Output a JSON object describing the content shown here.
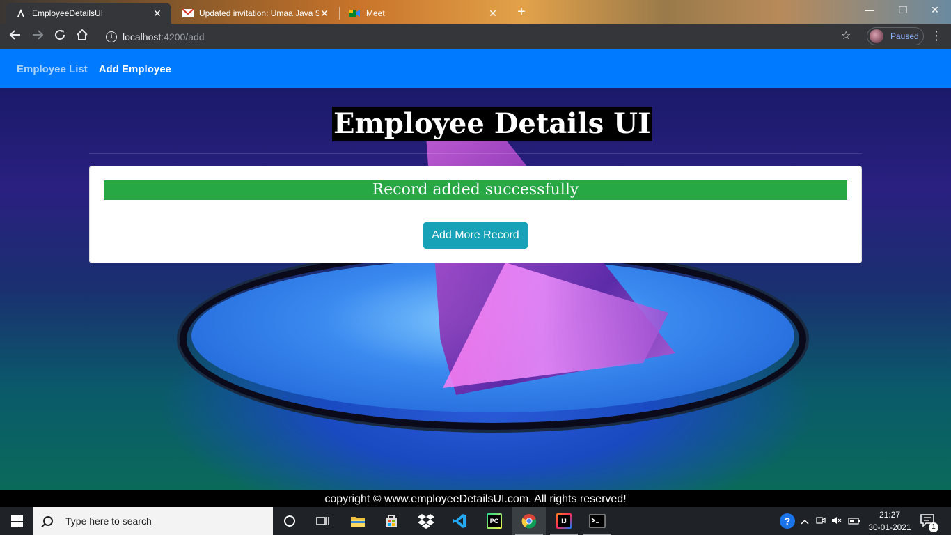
{
  "browser": {
    "tabs": [
      {
        "title": "EmployeeDetailsUI",
        "favicon": "A",
        "active": true
      },
      {
        "title": "Updated invitation: Umaa Java S",
        "favicon": "M",
        "active": false
      },
      {
        "title": "Meet",
        "favicon": "meet",
        "active": false
      }
    ],
    "close_glyph": "✕",
    "new_tab_glyph": "+",
    "url_host": "localhost",
    "url_path": ":4200/add",
    "profile_label": "Paused"
  },
  "navbar": {
    "links": [
      {
        "label": "Employee List",
        "active": false
      },
      {
        "label": "Add Employee",
        "active": true
      }
    ],
    "color": "#007bff"
  },
  "main": {
    "title": "Employee Details UI",
    "alert_text": "Record added successfully",
    "alert_color": "#28a745",
    "button_label": "Add More Record",
    "button_color": "#17a2b8"
  },
  "footer": {
    "text": "copyright © www.employeeDetailsUI.com. All rights reserved!"
  },
  "taskbar": {
    "search_placeholder": "Type here to search",
    "time": "21:27",
    "date": "30-01-2021",
    "notification_count": "1",
    "apps": [
      "cortana-icon",
      "task-view-icon",
      "file-explorer-icon",
      "store-icon",
      "dropbox-icon",
      "vscode-icon",
      "pycharm-icon",
      "chrome-icon",
      "intellij-icon",
      "terminal-icon"
    ]
  }
}
